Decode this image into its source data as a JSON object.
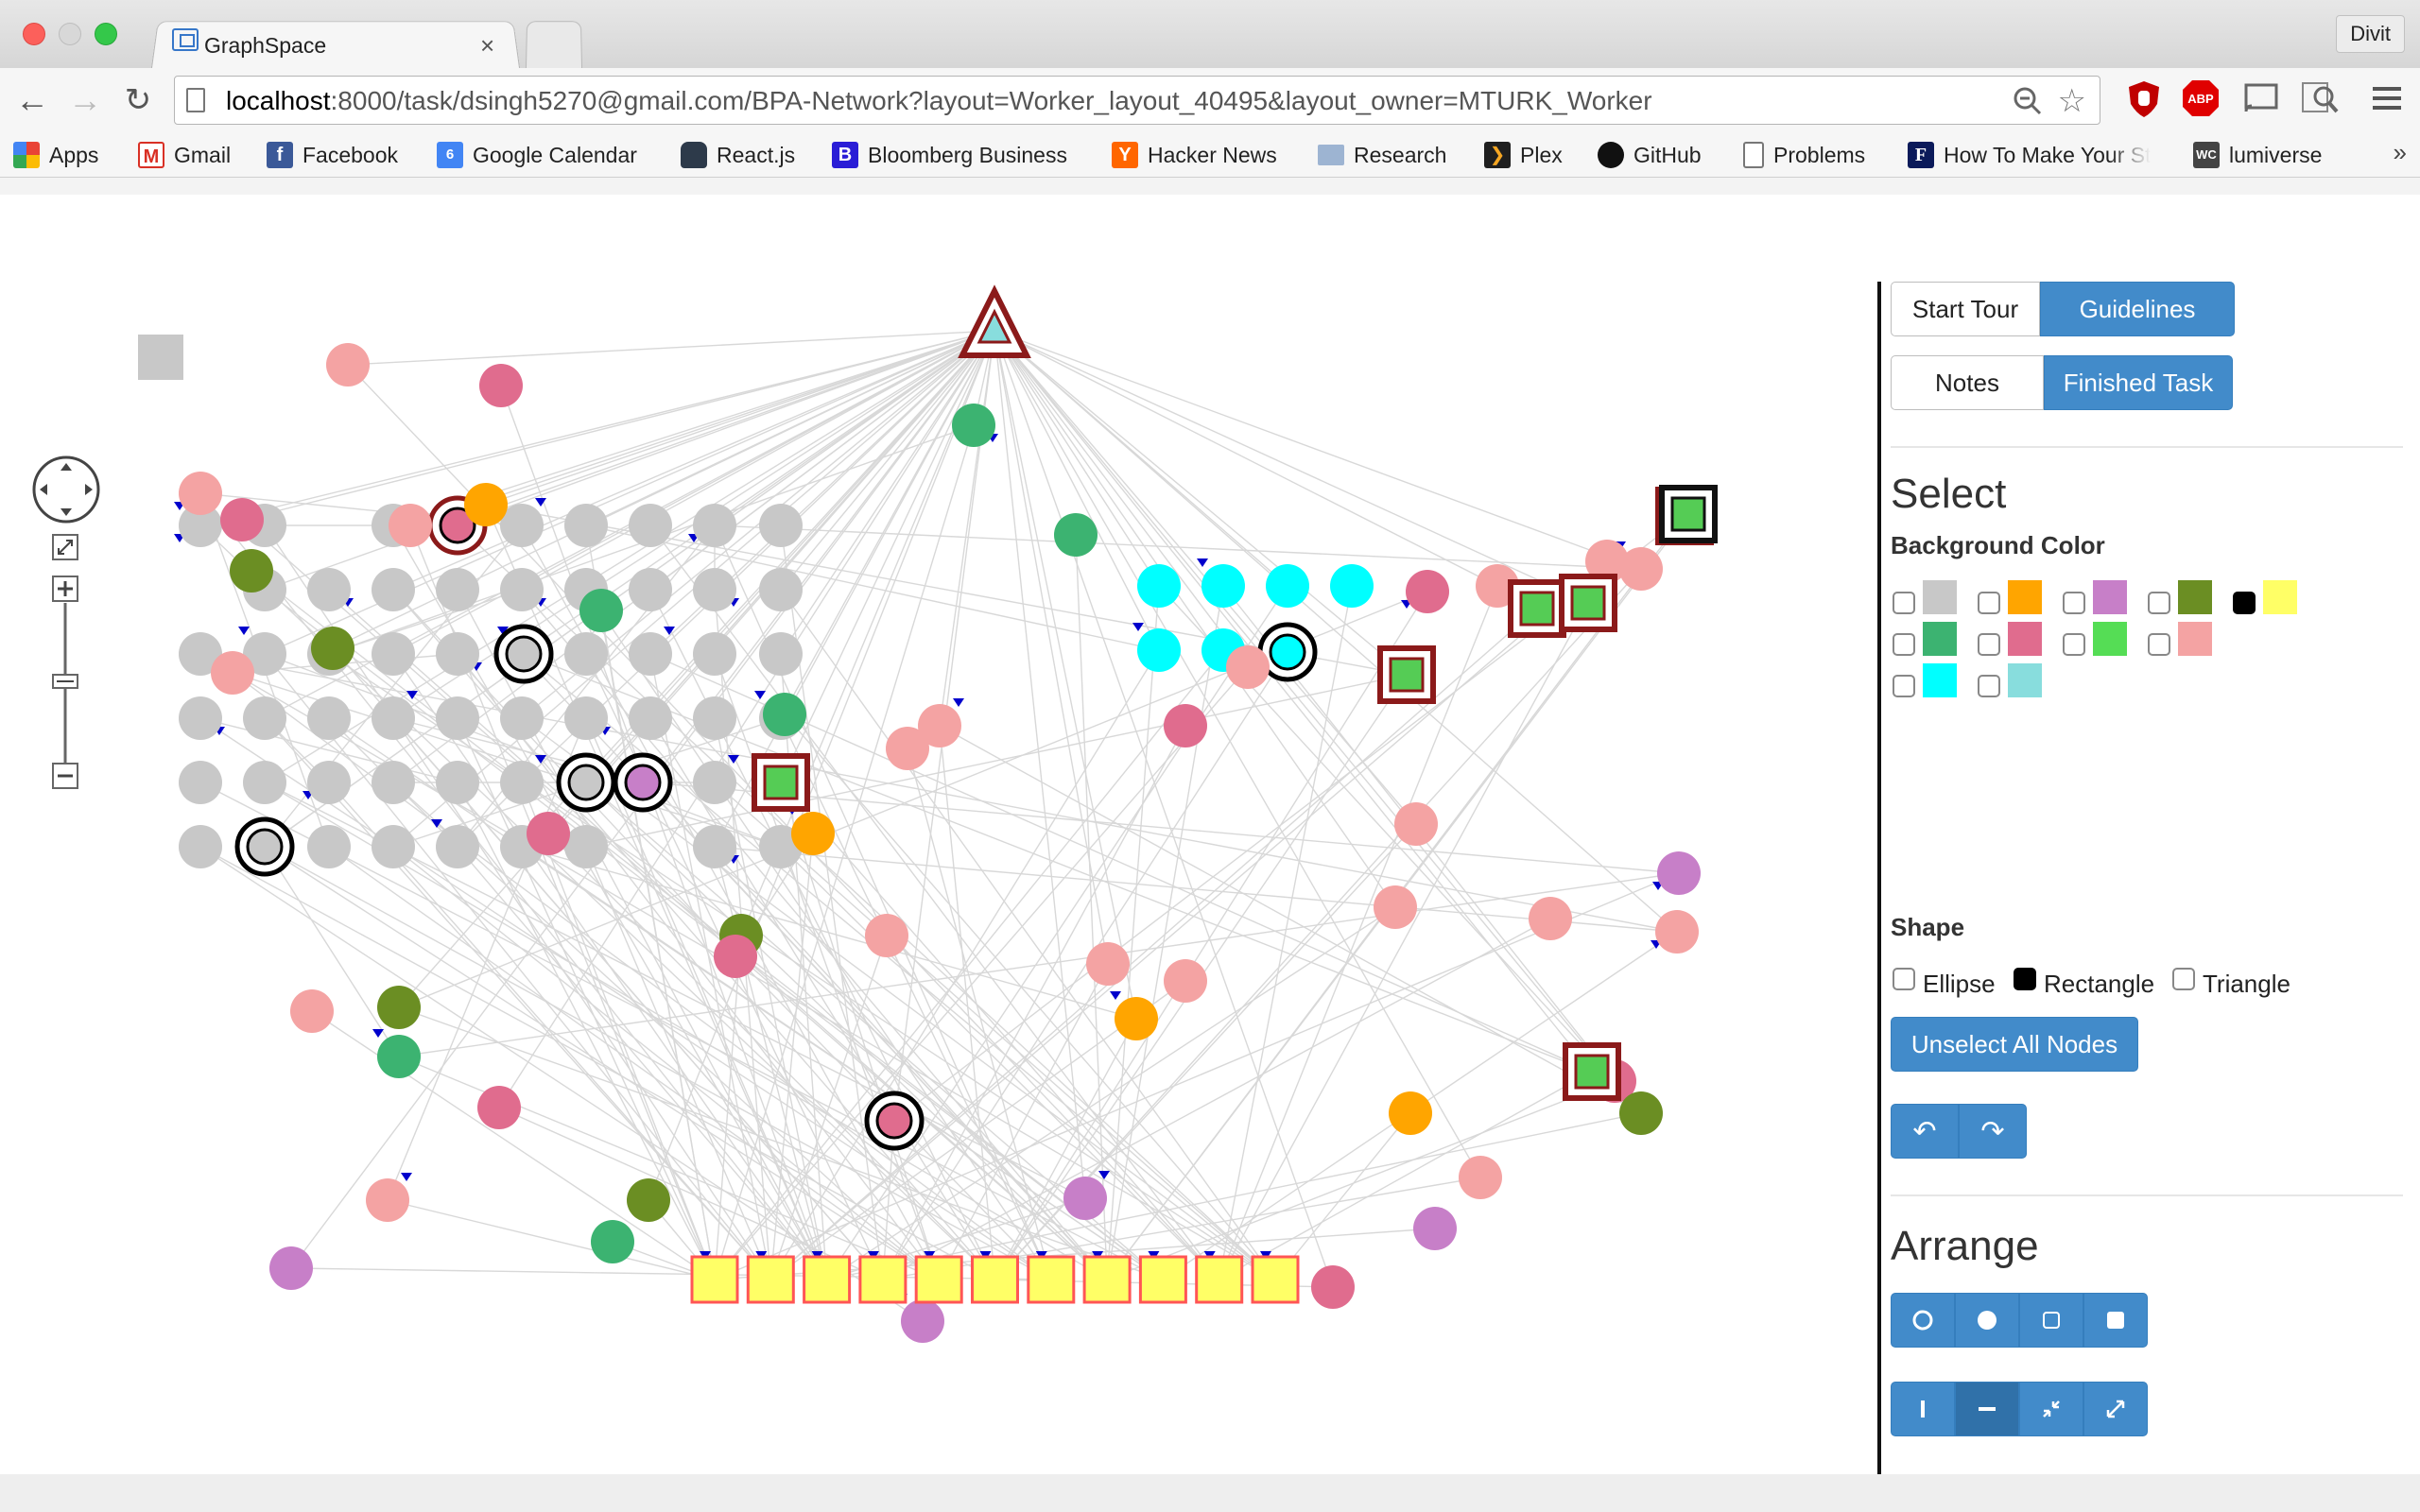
{
  "browser": {
    "tab_title": "GraphSpace",
    "tab_close": "×",
    "profile": "Divit",
    "url_host": "localhost",
    "url_rest": ":8000/task/dsingh5270@gmail.com/BPA-Network?layout=Worker_layout_40495&layout_owner=MTURK_Worker",
    "extensions": [
      "ublock-icon",
      "adblock-icon",
      "cast-icon",
      "search-ext-icon",
      "menu-icon"
    ],
    "adblock_label": "ABP",
    "bookmarks": [
      {
        "label": "Apps",
        "icon": "apps-grid-icon",
        "color": "#e94335"
      },
      {
        "label": "Gmail",
        "icon": "gmail-icon",
        "color": "#d93025"
      },
      {
        "label": "Facebook",
        "icon": "facebook-icon",
        "color": "#3b5998"
      },
      {
        "label": "Google Calendar",
        "icon": "calendar-icon",
        "color": "#4285f4"
      },
      {
        "label": "React.js",
        "icon": "react-icon",
        "color": "#2d3a4a"
      },
      {
        "label": "Bloomberg Business",
        "icon": "bloomberg-icon",
        "color": "#2a1dd6"
      },
      {
        "label": "Hacker News",
        "icon": "hackernews-icon",
        "color": "#ff6600"
      },
      {
        "label": "Research",
        "icon": "folder-icon",
        "color": "#8fa8c8"
      },
      {
        "label": "Plex",
        "icon": "plex-icon",
        "color": "#1f1f1f"
      },
      {
        "label": "GitHub",
        "icon": "github-icon",
        "color": "#111111"
      },
      {
        "label": "Problems",
        "icon": "page-icon",
        "color": "#777777"
      },
      {
        "label": "How To Make Your St",
        "icon": "forbes-icon",
        "color": "#0b1a5a"
      },
      {
        "label": "lumiverse",
        "icon": "wc-icon",
        "color": "#444444"
      }
    ],
    "bookmark_more": "»"
  },
  "panel": {
    "start_tour": "Start Tour",
    "guidelines": "Guidelines",
    "notes": "Notes",
    "finished_task": "Finished Task",
    "select_heading": "Select",
    "background_color_heading": "Background Color",
    "colors": [
      "#c8c8c8",
      "#ffa500",
      "#c77fc8",
      "#6b8e23",
      "#ffff66",
      "#3cb371",
      "#e06c8e",
      "#55dd55",
      "#f4a3a3",
      "#00ffff",
      "#88dddd"
    ],
    "shape_heading": "Shape",
    "shapes": [
      "Ellipse",
      "Rectangle",
      "Triangle"
    ],
    "unselect_all": "Unselect All Nodes",
    "arrange_heading": "Arrange"
  },
  "graph": {
    "palette": {
      "gray": "#c8c8c8",
      "pink": "#f4a3a3",
      "rose": "#e06c8e",
      "green": "#3cb371",
      "olive": "#6b8e23",
      "orange": "#ffa500",
      "cyan": "#00ffff",
      "purple": "#c77fc8",
      "yellow": "#ffff66",
      "boxgreen": "#55cc55",
      "teal": "#88dddd",
      "arrow": "#0000cc",
      "edge": "#d8d8d8"
    }
  }
}
